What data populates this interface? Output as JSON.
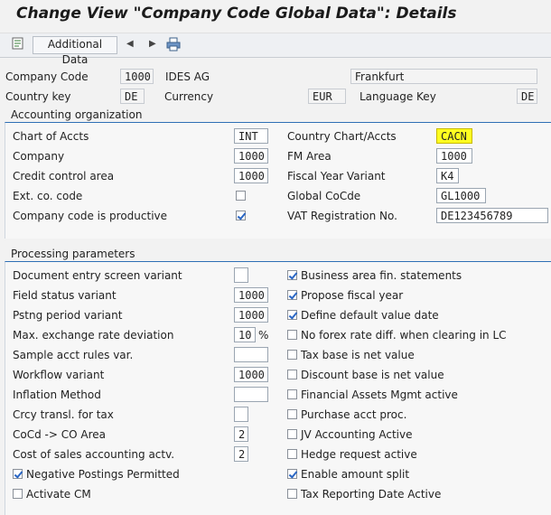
{
  "title": "Change View \"Company Code Global Data\": Details",
  "toolbar": {
    "additional_data": "Additional Data"
  },
  "header": {
    "company_code_label": "Company Code",
    "company_code": "1000",
    "company_name": "IDES AG",
    "city": "Frankfurt",
    "country_key_label": "Country key",
    "country_key": "DE",
    "currency_label": "Currency",
    "currency": "EUR",
    "language_key_label": "Language Key",
    "language_key": "DE"
  },
  "accounting": {
    "title": "Accounting organization",
    "chart_of_accts_label": "Chart of Accts",
    "chart_of_accts": "INT",
    "country_chart_label": "Country Chart/Accts",
    "country_chart": "CACN",
    "company_label": "Company",
    "company": "1000",
    "fm_area_label": "FM Area",
    "fm_area": "1000",
    "credit_control_label": "Credit control area",
    "credit_control": "1000",
    "fiscal_year_label": "Fiscal Year Variant",
    "fiscal_year": "K4",
    "ext_co_code_label": "Ext. co. code",
    "global_cocde_label": "Global CoCde",
    "global_cocde": "GL1000",
    "productive_label": "Company code is productive",
    "vat_label": "VAT Registration No.",
    "vat": "DE123456789"
  },
  "processing": {
    "title": "Processing parameters",
    "doc_entry_label": "Document entry screen variant",
    "doc_entry": "",
    "field_status_label": "Field status variant",
    "field_status": "1000",
    "pstng_period_label": "Pstng period variant",
    "pstng_period": "1000",
    "max_exch_label": "Max. exchange rate deviation",
    "max_exch": "10",
    "percent": "%",
    "sample_acct_label": "Sample acct rules var.",
    "sample_acct": "",
    "workflow_label": "Workflow variant",
    "workflow": "1000",
    "inflation_label": "Inflation Method",
    "inflation": "",
    "crcy_transl_label": "Crcy transl. for tax",
    "crcy_transl": "",
    "cocd_co_label": "CoCd -> CO Area",
    "cocd_co": "2",
    "cost_sales_label": "Cost of sales accounting actv.",
    "cost_sales": "2",
    "neg_postings_label": "Negative Postings Permitted",
    "activate_cm_label": "Activate CM",
    "right": [
      {
        "label": "Business area fin. statements",
        "checked": true
      },
      {
        "label": "Propose fiscal year",
        "checked": true
      },
      {
        "label": "Define default value date",
        "checked": true
      },
      {
        "label": "No forex rate diff. when clearing in LC",
        "checked": false
      },
      {
        "label": "Tax base is net value",
        "checked": false
      },
      {
        "label": "Discount base is net value",
        "checked": false
      },
      {
        "label": "Financial Assets Mgmt active",
        "checked": false
      },
      {
        "label": "Purchase acct proc.",
        "checked": false
      },
      {
        "label": "JV Accounting Active",
        "checked": false
      },
      {
        "label": "Hedge request active",
        "checked": false
      },
      {
        "label": "Enable amount split",
        "checked": true
      },
      {
        "label": "Tax Reporting Date Active",
        "checked": false
      }
    ]
  }
}
